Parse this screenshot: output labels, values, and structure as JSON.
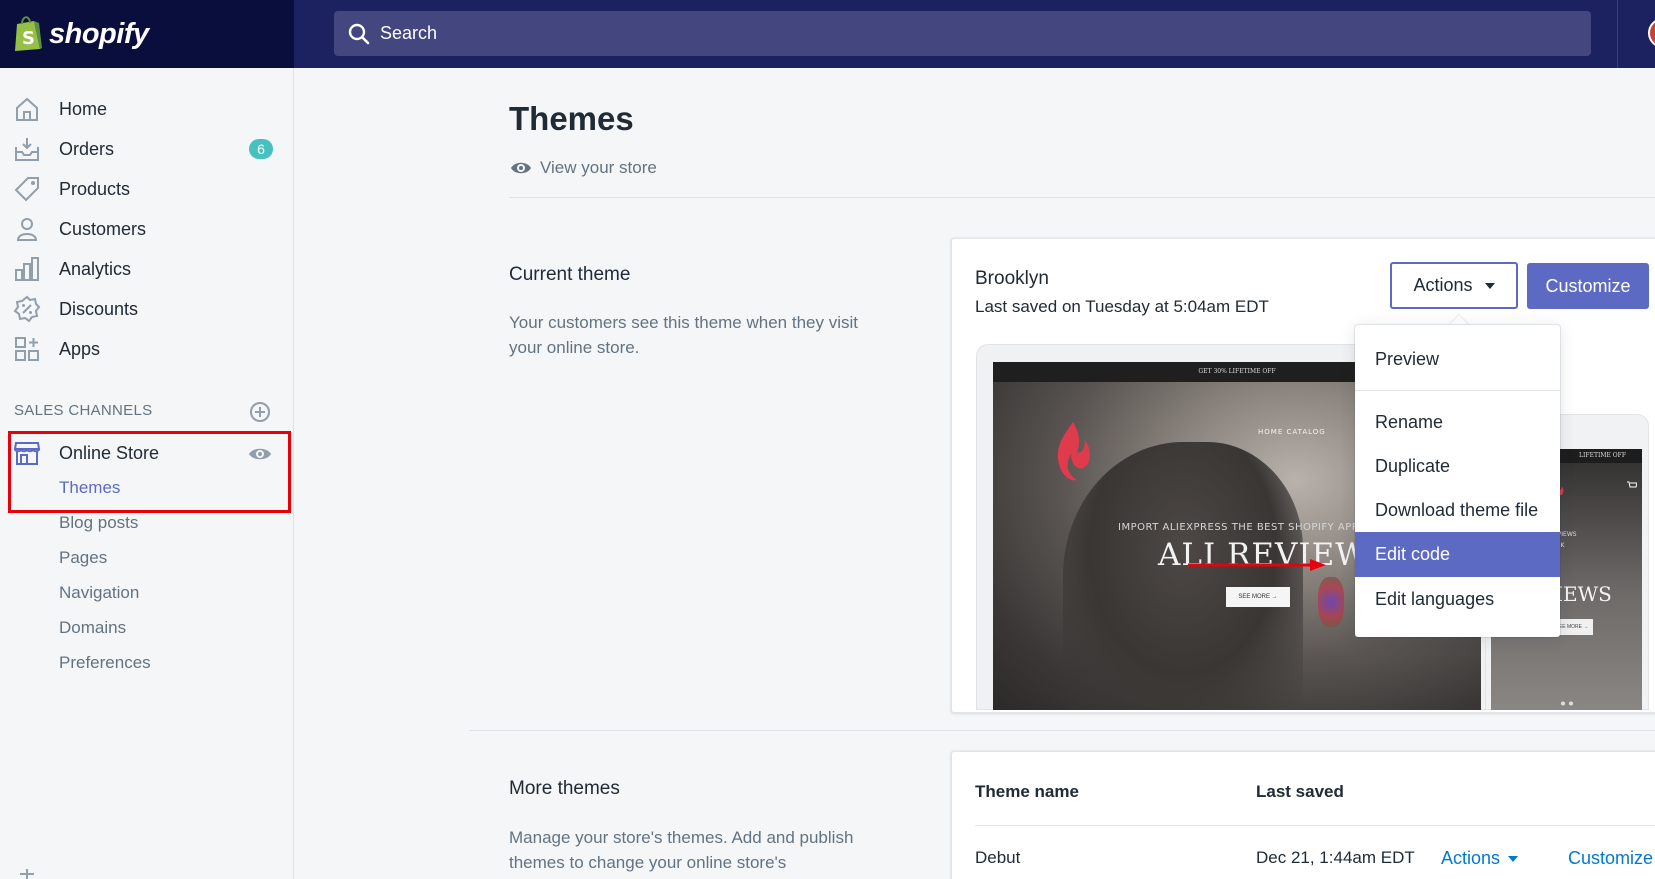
{
  "app": {
    "brand_name": "shopify",
    "search_placeholder": "Search",
    "colors": {
      "topbar": "#1c2260",
      "brand_bg": "#0a0e3d",
      "accent": "#5c6ac4",
      "link": "#007ace",
      "badge": "#47c1bf",
      "highlight": "#e8000b"
    }
  },
  "sidebar": {
    "items": [
      {
        "label": "Home",
        "icon": "home-icon"
      },
      {
        "label": "Orders",
        "icon": "orders-icon",
        "badge": "6"
      },
      {
        "label": "Products",
        "icon": "tag-icon"
      },
      {
        "label": "Customers",
        "icon": "person-icon"
      },
      {
        "label": "Analytics",
        "icon": "bar-chart-icon"
      },
      {
        "label": "Discounts",
        "icon": "discount-icon"
      },
      {
        "label": "Apps",
        "icon": "apps-icon"
      }
    ],
    "sales_channels_title": "SALES CHANNELS",
    "online_store": {
      "label": "Online Store",
      "subitems": [
        "Themes",
        "Blog posts",
        "Pages",
        "Navigation",
        "Domains",
        "Preferences"
      ]
    }
  },
  "main": {
    "title": "Themes",
    "view_store": "View your store",
    "current_theme": {
      "section_title": "Current theme",
      "section_desc": "Your customers see this theme when they visit your online store.",
      "name": "Brooklyn",
      "last_saved": "Last saved on Tuesday at 5:04am EDT",
      "actions_label": "Actions",
      "customize_label": "Customize"
    },
    "preview": {
      "desktop_bar": "GET 30% LIFETIME OFF",
      "nav": "HOME    CATALOG",
      "small_text": "IMPORT ALIEXPRESS THE BEST SHOPIFY APPS STORE",
      "big_text": "ALI REVIEWS",
      "button": "SEE MORE →",
      "mobile_bar": "LIFETIME OFF",
      "mobile_small_1": "ALIEXPRESS REVIEWS",
      "mobile_small_2": "STORE IN 1 CLICK",
      "mobile_big_1": "ALI",
      "mobile_big_2": "REVIEWS",
      "mobile_button": "SEE MORE →"
    },
    "actions_menu": {
      "items": [
        "Preview",
        "Rename",
        "Duplicate",
        "Download theme file",
        "Edit code",
        "Edit languages"
      ],
      "selected": "Edit code"
    },
    "more_themes": {
      "section_title": "More themes",
      "section_desc": "Manage your store's themes. Add and publish themes to change your online store's",
      "columns": [
        "Theme name",
        "Last saved"
      ],
      "rows": [
        {
          "name": "Debut",
          "last_saved": "Dec 21, 1:44am EDT",
          "actions": "Actions",
          "customize": "Customize"
        }
      ]
    }
  }
}
